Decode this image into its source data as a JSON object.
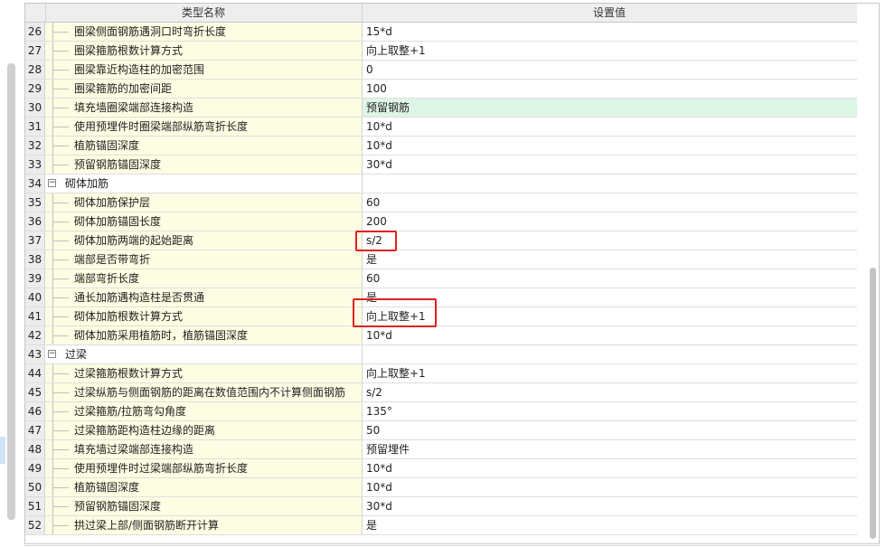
{
  "header": {
    "name_col": "类型名称",
    "value_col": "设置值"
  },
  "rows": [
    {
      "num": "26",
      "name": "圈梁侧面钢筋遇洞口时弯折长度",
      "value": "15*d",
      "type": "item"
    },
    {
      "num": "27",
      "name": "圈梁箍筋根数计算方式",
      "value": "向上取整+1",
      "type": "item"
    },
    {
      "num": "28",
      "name": "圈梁靠近构造柱的加密范围",
      "value": "0",
      "type": "item"
    },
    {
      "num": "29",
      "name": "圈梁箍筋的加密间距",
      "value": "100",
      "type": "item"
    },
    {
      "num": "30",
      "name": "填充墙圈梁端部连接构造",
      "value": "预留钢筋",
      "type": "item",
      "highlight": true
    },
    {
      "num": "31",
      "name": "使用预埋件时圈梁端部纵筋弯折长度",
      "value": "10*d",
      "type": "item"
    },
    {
      "num": "32",
      "name": "植筋锚固深度",
      "value": "10*d",
      "type": "item"
    },
    {
      "num": "33",
      "name": "预留钢筋锚固深度",
      "value": "30*d",
      "type": "item"
    },
    {
      "num": "34",
      "name": "砌体加筋",
      "value": "",
      "type": "group"
    },
    {
      "num": "35",
      "name": "砌体加筋保护层",
      "value": "60",
      "type": "item"
    },
    {
      "num": "36",
      "name": "砌体加筋锚固长度",
      "value": "200",
      "type": "item"
    },
    {
      "num": "37",
      "name": "砌体加筋两端的起始距离",
      "value": "s/2",
      "type": "item"
    },
    {
      "num": "38",
      "name": "端部是否带弯折",
      "value": "是",
      "type": "item"
    },
    {
      "num": "39",
      "name": "端部弯折长度",
      "value": "60",
      "type": "item"
    },
    {
      "num": "40",
      "name": "通长加筋遇构造柱是否贯通",
      "value": "是",
      "type": "item"
    },
    {
      "num": "41",
      "name": "砌体加筋根数计算方式",
      "value": "向上取整+1",
      "type": "item"
    },
    {
      "num": "42",
      "name": "砌体加筋采用植筋时，植筋锚固深度",
      "value": "10*d",
      "type": "item"
    },
    {
      "num": "43",
      "name": "过梁",
      "value": "",
      "type": "group"
    },
    {
      "num": "44",
      "name": "过梁箍筋根数计算方式",
      "value": "向上取整+1",
      "type": "item"
    },
    {
      "num": "45",
      "name": "过梁纵筋与侧面钢筋的距离在数值范围内不计算侧面钢筋",
      "value": "s/2",
      "type": "item"
    },
    {
      "num": "46",
      "name": "过梁箍筋/拉筋弯勾角度",
      "value": "135°",
      "type": "item"
    },
    {
      "num": "47",
      "name": "过梁箍筋距构造柱边缘的距离",
      "value": "50",
      "type": "item"
    },
    {
      "num": "48",
      "name": "填充墙过梁端部连接构造",
      "value": "预留埋件",
      "type": "item"
    },
    {
      "num": "49",
      "name": "使用预埋件时过梁端部纵筋弯折长度",
      "value": "10*d",
      "type": "item"
    },
    {
      "num": "50",
      "name": "植筋锚固深度",
      "value": "10*d",
      "type": "item"
    },
    {
      "num": "51",
      "name": "预留钢筋锚固深度",
      "value": "30*d",
      "type": "item"
    },
    {
      "num": "52",
      "name": "拱过梁上部/侧面钢筋断开计算",
      "value": "是",
      "type": "item"
    }
  ],
  "collapse_symbol": "−",
  "colors": {
    "highlight_row": "#ddf5e7",
    "name_cell": "#fdfde3",
    "annotation": "#e02020"
  }
}
